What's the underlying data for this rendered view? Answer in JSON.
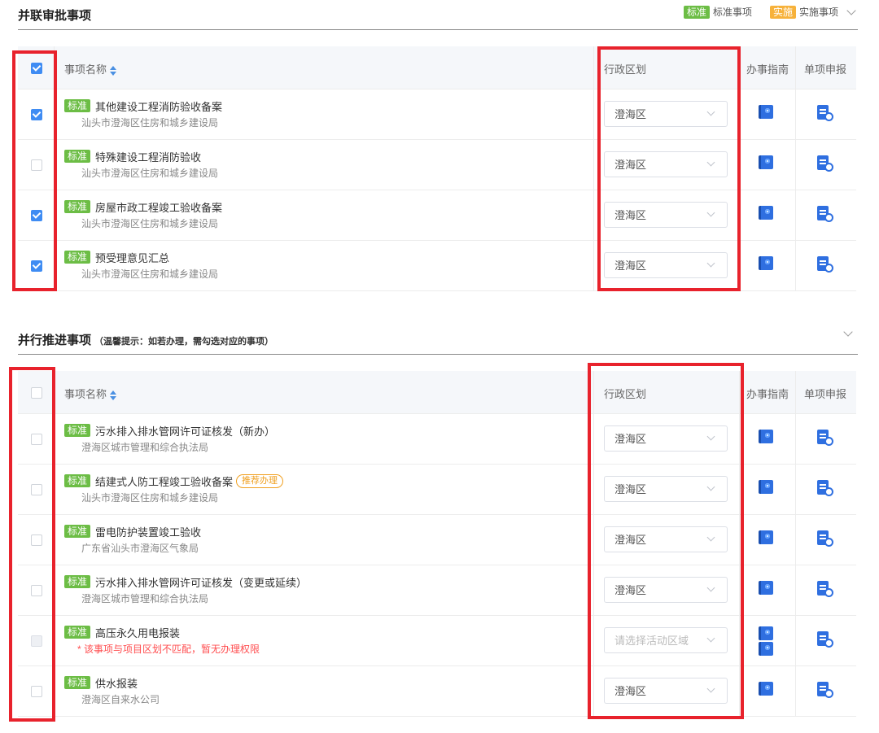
{
  "section1": {
    "title": "并联审批事项",
    "legend": {
      "std_tag": "标准",
      "std_text": "标准事项",
      "impl_tag": "实施",
      "impl_text": "实施事项"
    },
    "columns": {
      "name": "事项名称",
      "region": "行政区划",
      "guide": "办事指南",
      "report": "单项申报"
    },
    "header_checked": true,
    "rows": [
      {
        "tag": "标准",
        "name": "其他建设工程消防验收备案",
        "dept": "汕头市澄海区住房和城乡建设局",
        "region": "澄海区",
        "checked": true
      },
      {
        "tag": "标准",
        "name": "特殊建设工程消防验收",
        "dept": "汕头市澄海区住房和城乡建设局",
        "region": "澄海区",
        "checked": false
      },
      {
        "tag": "标准",
        "name": "房屋市政工程竣工验收备案",
        "dept": "汕头市澄海区住房和城乡建设局",
        "region": "澄海区",
        "checked": true
      },
      {
        "tag": "标准",
        "name": "预受理意见汇总",
        "dept": "汕头市澄海区住房和城乡建设局",
        "region": "澄海区",
        "checked": true
      }
    ]
  },
  "section2": {
    "title": "并行推进事项",
    "hint": "（温馨提示：如若办理，需勾选对应的事项）",
    "columns": {
      "name": "事项名称",
      "region": "行政区划",
      "guide": "办事指南",
      "report": "单项申报"
    },
    "rows": [
      {
        "tag": "标准",
        "name": "污水排入排水管网许可证核发（新办）",
        "dept": "澄海区城市管理和综合执法局",
        "region": "澄海区"
      },
      {
        "tag": "标准",
        "name": "结建式人防工程竣工验收备案",
        "badge": "推荐办理",
        "dept": "汕头市澄海区住房和城乡建设局",
        "region": "澄海区"
      },
      {
        "tag": "标准",
        "name": "雷电防护装置竣工验收",
        "dept": "广东省汕头市澄海区气象局",
        "region": "澄海区"
      },
      {
        "tag": "标准",
        "name": "污水排入排水管网许可证核发（变更或延续）",
        "dept": "澄海区城市管理和综合执法局",
        "region": "澄海区"
      },
      {
        "tag": "标准",
        "name": "高压永久用电报装",
        "warning": "* 该事项与项目区划不匹配，暂无办理权限",
        "region_placeholder": "请选择活动区域"
      },
      {
        "tag": "标准",
        "name": "供水报装",
        "dept": "澄海区自来水公司",
        "region": "澄海区"
      }
    ]
  },
  "colors": {
    "tag_standard": "#6cbd45",
    "tag_implement": "#f7b23b",
    "checkbox_checked": "#3f8cf3",
    "highlight_box": "#e8222c",
    "warning_text": "#ff4d4f",
    "icon_blue": "#2f6fe0"
  }
}
